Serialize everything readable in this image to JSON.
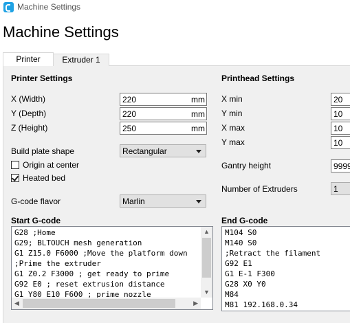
{
  "window": {
    "title": "Machine Settings",
    "heading": "Machine Settings"
  },
  "tabs": [
    {
      "label": "Printer",
      "selected": true
    },
    {
      "label": "Extruder 1",
      "selected": false
    }
  ],
  "printer_settings": {
    "title": "Printer Settings",
    "width": {
      "label": "X (Width)",
      "value": "220",
      "unit": "mm"
    },
    "depth": {
      "label": "Y (Depth)",
      "value": "220",
      "unit": "mm"
    },
    "height": {
      "label": "Z (Height)",
      "value": "250",
      "unit": "mm"
    },
    "build_plate_shape": {
      "label": "Build plate shape",
      "value": "Rectangular"
    },
    "origin_at_center": {
      "label": "Origin at center",
      "checked": false
    },
    "heated_bed": {
      "label": "Heated bed",
      "checked": true
    },
    "gcode_flavor": {
      "label": "G-code flavor",
      "value": "Marlin"
    }
  },
  "printhead_settings": {
    "title": "Printhead Settings",
    "x_min": {
      "label": "X min",
      "value": "20"
    },
    "y_min": {
      "label": "Y min",
      "value": "10"
    },
    "x_max": {
      "label": "X max",
      "value": "10"
    },
    "y_max": {
      "label": "Y max",
      "value": "10"
    },
    "gantry_height": {
      "label": "Gantry height",
      "value": "9999"
    },
    "number_of_extruders": {
      "label": "Number of Extruders",
      "value": "1"
    }
  },
  "start_gcode": {
    "title": "Start G-code",
    "text": "G28 ;Home\nG29; BLTOUCH mesh generation\nG1 Z15.0 F6000 ;Move the platform down\n;Prime the extruder\nG1 Z0.2 F3000 ; get ready to prime\nG92 E0 ; reset extrusion distance\nG1 Y80 E10 F600 ; prime nozzle"
  },
  "end_gcode": {
    "title": "End G-code",
    "text": "M104 S0\nM140 S0\n;Retract the filament\nG92 E1\nG1 E-1 F300\nG28 X0 Y0\nM84\nM81 192.168.0.34"
  },
  "colors": {
    "app_icon": "#1fa2e4",
    "panel_bg": "#f0f0f0",
    "combo_bg": "#e1e1e1"
  }
}
